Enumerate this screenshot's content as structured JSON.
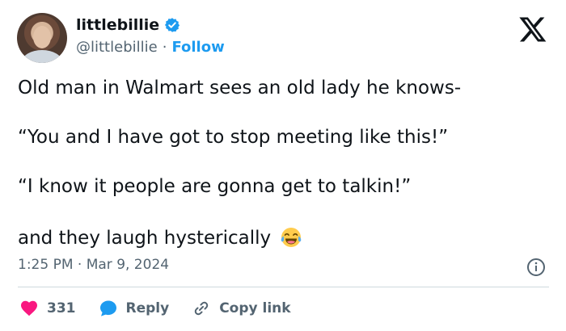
{
  "user": {
    "name": "littlebillie",
    "handle": "@littlebillie",
    "separator": "·",
    "follow_label": "Follow"
  },
  "tweet": {
    "lines": [
      "Old man in Walmart sees an old lady he knows-",
      "“You and I have got to stop meeting like this!”",
      "“I know it people are gonna get to talkin!”",
      "and they laugh hysterically"
    ],
    "emoji": "face-with-tears-of-joy",
    "timestamp": "1:25 PM · Mar 9, 2024"
  },
  "actions": {
    "likes_count": "331",
    "reply_label": "Reply",
    "copy_label": "Copy link"
  },
  "colors": {
    "text": "#0f1419",
    "secondary": "#536471",
    "accent": "#1d9bf0",
    "like": "#f91880",
    "divider": "#cfd9de"
  },
  "icons": [
    "verified-badge-icon",
    "x-logo-icon",
    "info-icon",
    "heart-icon",
    "reply-bubble-icon",
    "link-icon"
  ]
}
